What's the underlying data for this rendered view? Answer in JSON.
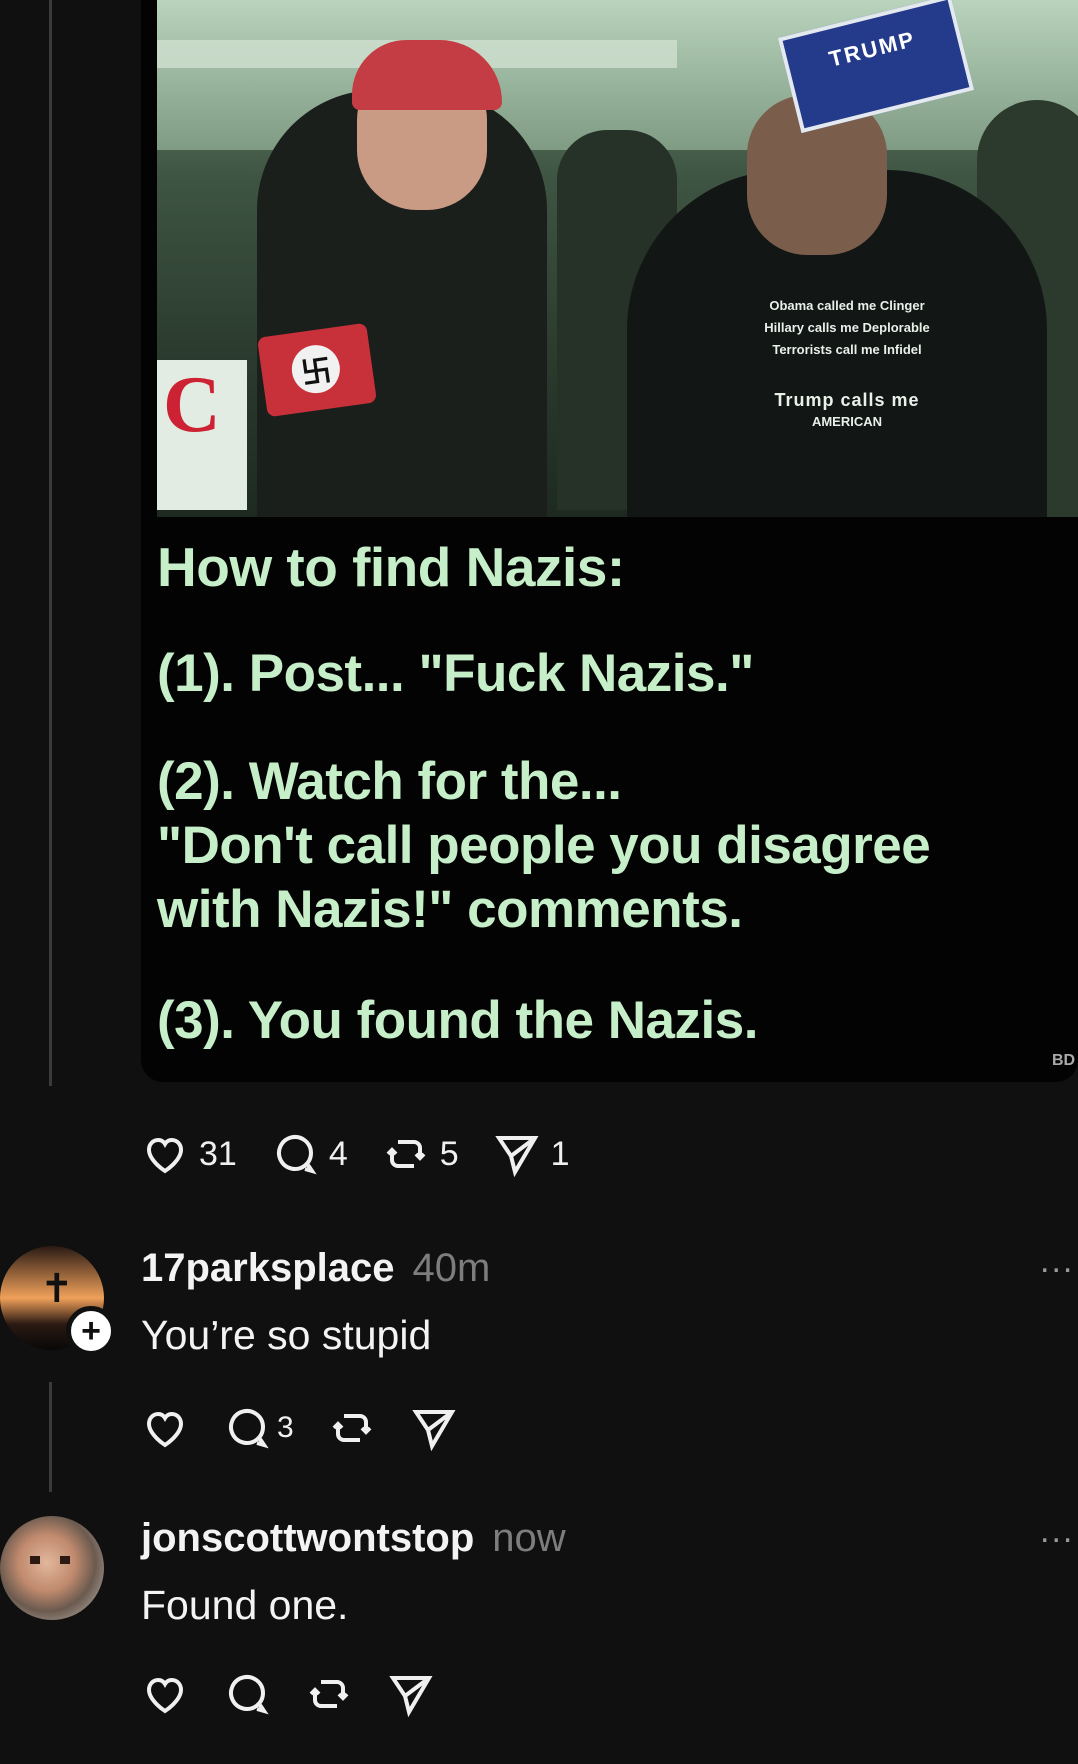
{
  "post": {
    "meme": {
      "sign_text": "TRUMP",
      "shirt_lines": [
        "Obama called me Clinger",
        "Hillary calls me Deplorable",
        "Terrorists call me Infidel"
      ],
      "shirt_lines_2": [
        "Trump calls me",
        "AMERICAN"
      ],
      "sign_left_text": "C",
      "heading": "How to find Nazis:",
      "step1": "(1).  Post... \"Fuck Nazis.\"",
      "step2": "(2).  Watch for the...",
      "step2_quote_1": "\"Don't call people you disagree",
      "step2_quote_2": "with Nazis!\" comments.",
      "step3": "(3).  You found the Nazis.",
      "watermark": "BD"
    },
    "actions": {
      "likes": "31",
      "replies": "4",
      "reposts": "5",
      "shares": "1"
    }
  },
  "replies": [
    {
      "username": "17parksplace",
      "time": "40m",
      "text": "You’re so stupid",
      "follow_symbol": "+",
      "more": "...",
      "actions": {
        "replies": "3"
      }
    },
    {
      "username": "jonscottwontstop",
      "time": "now",
      "text": "Found one.",
      "more": "..."
    }
  ],
  "icons": [
    "heart-icon",
    "comment-icon",
    "repost-icon",
    "share-icon",
    "more-icon",
    "plus-icon"
  ],
  "colors": {
    "background": "#101010",
    "meme_text": "#c6efc9",
    "muted": "#7d7d7d"
  }
}
